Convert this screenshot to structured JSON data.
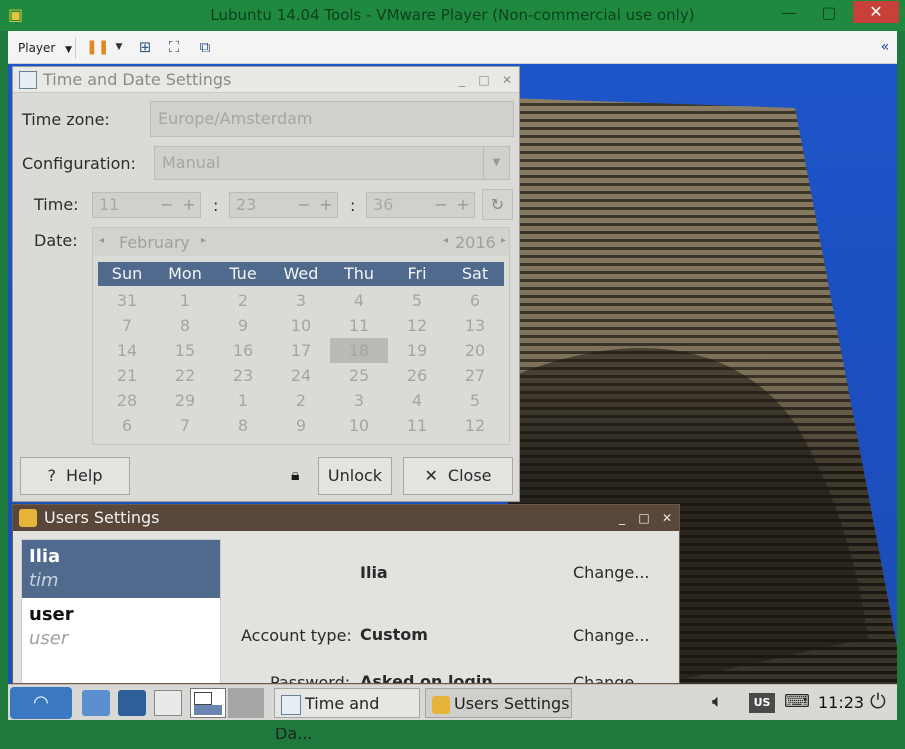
{
  "vmware": {
    "title": "Lubuntu 14.04 Tools - VMware Player (Non-commercial use only)",
    "toolbar": {
      "player_label": "Player",
      "collapse_icon": "double-chevron-left"
    }
  },
  "time_date": {
    "title": "Time and Date Settings",
    "timezone_label": "Time zone:",
    "timezone_value": "Europe/Amsterdam",
    "config_label": "Configuration:",
    "config_value": "Manual",
    "time_label": "Time:",
    "hours": "11",
    "minutes": "23",
    "seconds": "36",
    "date_label": "Date:",
    "month": "February",
    "year": "2016",
    "weekdays": [
      "Sun",
      "Mon",
      "Tue",
      "Wed",
      "Thu",
      "Fri",
      "Sat"
    ],
    "weeks": [
      [
        "31",
        "1",
        "2",
        "3",
        "4",
        "5",
        "6"
      ],
      [
        "7",
        "8",
        "9",
        "10",
        "11",
        "12",
        "13"
      ],
      [
        "14",
        "15",
        "16",
        "17",
        "18",
        "19",
        "20"
      ],
      [
        "21",
        "22",
        "23",
        "24",
        "25",
        "26",
        "27"
      ],
      [
        "28",
        "29",
        "1",
        "2",
        "3",
        "4",
        "5"
      ],
      [
        "6",
        "7",
        "8",
        "9",
        "10",
        "11",
        "12"
      ]
    ],
    "selected_day": "18",
    "help_label": "Help",
    "unlock_label": "Unlock",
    "close_label": "Close"
  },
  "users": {
    "title": "Users Settings",
    "list": [
      {
        "name": "Ilia",
        "login": "tim"
      },
      {
        "name": "user",
        "login": "user"
      }
    ],
    "detail_name": "Ilia",
    "change_label": "Change...",
    "account_type_label": "Account type:",
    "account_type_value": "Custom",
    "password_label": "Password:",
    "password_value": "Asked on login"
  },
  "taskbar": {
    "task1": "Time and Da...",
    "task2": "Users Settings",
    "keyboard_layout": "US",
    "clock": "11:23"
  },
  "colors": {
    "vm_frame": "#1f8a3f",
    "calendar_header": "#4f6a8c",
    "users_titlebar": "#59473a",
    "selected_user": "#4f6a8c"
  }
}
